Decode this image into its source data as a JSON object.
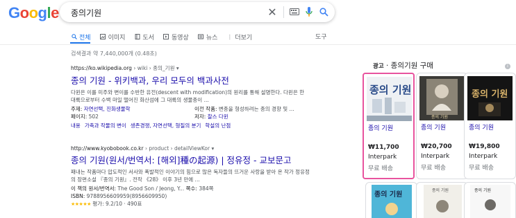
{
  "logo": {
    "text": "Google",
    "letters": [
      "G",
      "o",
      "o",
      "g",
      "l",
      "e"
    ],
    "colors": [
      "#4285F4",
      "#EA4335",
      "#FBBC05",
      "#4285F4",
      "#34A853",
      "#EA4335"
    ]
  },
  "search": {
    "query": "종의기원"
  },
  "tabs": [
    {
      "label": "전체",
      "icon": "search-icon",
      "active": true
    },
    {
      "label": "이미지",
      "icon": "image-icon"
    },
    {
      "label": "도서",
      "icon": "book-icon"
    },
    {
      "label": "동영상",
      "icon": "video-icon"
    },
    {
      "label": "뉴스",
      "icon": "news-icon"
    },
    {
      "label": "더보기",
      "icon": "more-vert-icon"
    }
  ],
  "tools_label": "도구",
  "stats": "검색결과 약 7,440,000개 (0.48초)",
  "results": [
    {
      "url": "https://ko.wikipedia.org",
      "crumbs": " › wiki › 종의_기원",
      "title": "종의 기원 - 위키백과, 우리 모두의 백과사전",
      "snippet": "다윈은 이를 미주와 변이를 수반한 유전(descent with modification)의 원리를 통해 설명한다. 다윈은 한 대륙으로부터 수백 마일 떨어진 화산섬에 그 대륙의 생물종이 ...",
      "facts": [
        {
          "key": "주제:",
          "value": "자연선택, 진화생물학"
        },
        {
          "key": "이전 작품:",
          "value": "변종을 형성하려는 종의 경향 및 ..."
        },
        {
          "key": "페이지:",
          "value": "502"
        },
        {
          "key": "저자:",
          "value": "찰스 다윈"
        }
      ],
      "sitelinks": [
        "내용",
        "가축과 작물의 변이",
        "생존경쟁, 자연선택, 형질의 분기",
        "학설의 난점"
      ]
    },
    {
      "url": "http://www.kyobobook.co.kr",
      "crumbs": " › product › detailViewKor",
      "title": "종의 기원(원서/번역서: [해외]種の起源) | 정유정 - 교보문고",
      "snippet": "패내는 작품마다 압도적인 서사와 폭발적인 이야기의 힘으로 많은 독자들의 뜨거운 사랑을 받아 온 작가 정유정의 장편소설 『종의 기원』. 전작 《28》 이후 3년 만에 ...",
      "original_key": "이 책의 원서/번역서:",
      "original_value": "The Good Son / Jeong, Y...",
      "pages_key": "쪽수:",
      "pages_value": "384쪽",
      "isbn_key": "ISBN:",
      "isbn_value": "9788956609959(8956609950)",
      "rating_stars": "★★★★★",
      "rating_text": "평가: 9.2/10 · 490표"
    }
  ],
  "shopping": {
    "ad_label": "광고",
    "title": " · 종의기원 구매",
    "info_icon": "i",
    "cards": [
      {
        "title": "종의 기원",
        "price": "₩11,700",
        "store": "Interpark",
        "shipping": "무료 배송",
        "cover_text": "종의 기원"
      },
      {
        "title": "종의 기원",
        "price": "₩20,700",
        "store": "Interpark",
        "shipping": "무료 배송",
        "cover_text": "종의 기원"
      },
      {
        "title": "종의 기원",
        "price": "₩19,800",
        "store": "Interpark",
        "shipping": "무료 배송",
        "cover_text": "종의 기원"
      }
    ],
    "bottom_cards": [
      {
        "cover_text": "종의 기원"
      },
      {
        "cover_text": "종의 기원"
      },
      {
        "cover_text": "종의 기원"
      }
    ]
  },
  "colors": {
    "link": "#1a0dab",
    "accent": "#1a73e8",
    "highlight": "#e8539e"
  }
}
